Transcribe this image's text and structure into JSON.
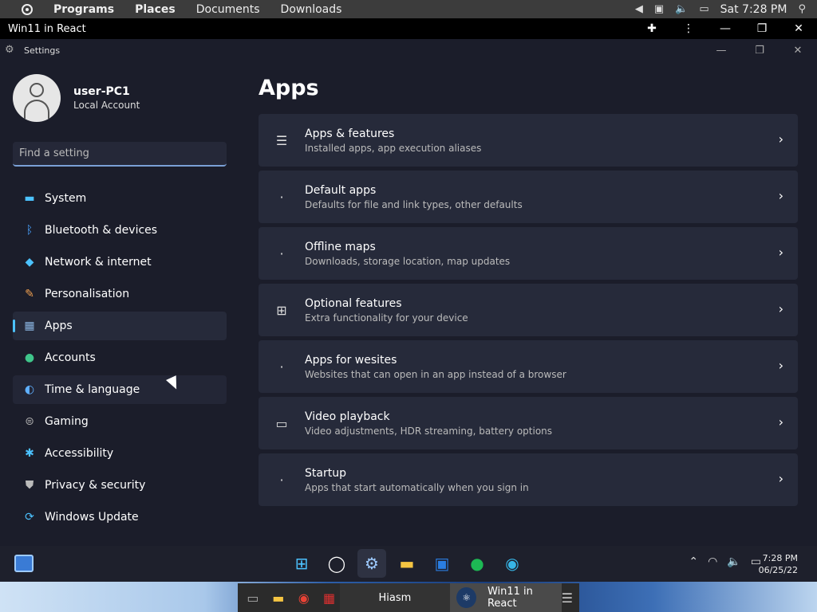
{
  "topbar": {
    "menus": [
      "Programs",
      "Places",
      "Documents",
      "Downloads"
    ],
    "clock": "Sat 7:28 PM"
  },
  "browser": {
    "title": "Win11 in React"
  },
  "settings": {
    "window_title": "Settings",
    "profile": {
      "name": "user-PC1",
      "type": "Local Account"
    },
    "search_placeholder": "Find a setting",
    "nav": [
      {
        "label": "System",
        "icon": "monitor-icon"
      },
      {
        "label": "Bluetooth & devices",
        "icon": "bluetooth-icon"
      },
      {
        "label": "Network & internet",
        "icon": "wifi-icon"
      },
      {
        "label": "Personalisation",
        "icon": "brush-icon"
      },
      {
        "label": "Apps",
        "icon": "apps-icon"
      },
      {
        "label": "Accounts",
        "icon": "person-icon"
      },
      {
        "label": "Time & language",
        "icon": "globe-clock-icon"
      },
      {
        "label": "Gaming",
        "icon": "gamepad-icon"
      },
      {
        "label": "Accessibility",
        "icon": "accessibility-icon"
      },
      {
        "label": "Privacy & security",
        "icon": "shield-icon"
      },
      {
        "label": "Windows Update",
        "icon": "update-icon"
      }
    ],
    "page_title": "Apps",
    "cards": [
      {
        "title": "Apps & features",
        "desc": "Installed apps, app execution aliases",
        "icon": "list-icon"
      },
      {
        "title": "Default apps",
        "desc": "Defaults for file and link types, other defaults",
        "icon": ""
      },
      {
        "title": "Offline maps",
        "desc": "Downloads, storage location, map updates",
        "icon": ""
      },
      {
        "title": "Optional features",
        "desc": "Extra functionality for your device",
        "icon": "add-grid-icon"
      },
      {
        "title": "Apps for wesites",
        "desc": "Websites that can open in an app instead of a browser",
        "icon": ""
      },
      {
        "title": "Video playback",
        "desc": "Video adjustments, HDR streaming, battery options",
        "icon": "video-icon"
      },
      {
        "title": "Startup",
        "desc": "Apps that start automatically when you sign in",
        "icon": ""
      }
    ]
  },
  "taskbar": {
    "time": "7:28 PM",
    "date": "06/25/22"
  },
  "host_panel": {
    "tasks": [
      "Hiasm",
      "Win11 in React"
    ]
  },
  "colors": {
    "accent": "#4cc2ff",
    "bg": "#1b1d2a",
    "card": "#262a3a"
  }
}
